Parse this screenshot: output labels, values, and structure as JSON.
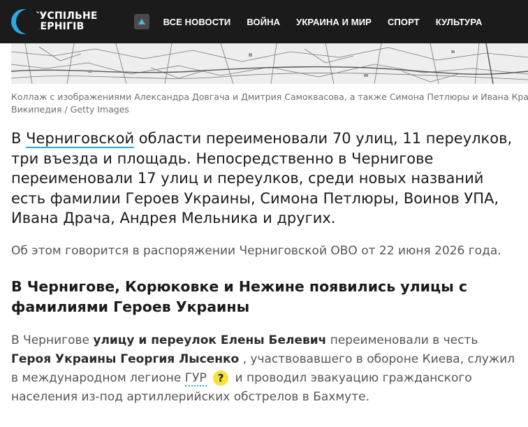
{
  "header": {
    "logo_line1": "СУСПІЛЬНЕ",
    "logo_line2": "ЧЕРНІГІВ",
    "nav": [
      "ВСЕ НОВОСТИ",
      "ВОЙНА",
      "УКРАИНА И МИР",
      "СПОРТ",
      "КУЛЬТУРА"
    ]
  },
  "image": {
    "caption_line1": "Коллаж с изображениями Александра Довгача и Дмитрия Самоквасова, а также Симона Петлюры и Ивана Краснос",
    "caption_line2": "Википедия / Getty Images"
  },
  "article": {
    "lead_before": "В ",
    "lead_link": "Черниговской",
    "lead_after": " области переименовали 70 улиц, 11 переулков, три въезда и площадь. Непосредственно в Чернигове переименовали 17 улиц и переулков, среди новых названий есть фамилии Героев Украины, Симона Петлюры, Воинов УПА, Ивана Драча, Андрея Мельника и других.",
    "p1": "Об этом говорится в распоряжении Черниговской ОВО от 22 июня 2026 года.",
    "h2": "В Чернигове, Корюковке и Нежине появились улицы с фамилиями Героев Украины",
    "p2_a": "В Чернигове ",
    "p2_b": "улицу и переулок Елены Белевич",
    "p2_c": " переименовали в честь ",
    "p2_d": "Героя Украины Георгия Лысенко",
    "p2_e": " , участвовавшего в обороне Киева, служил в международном легионе ",
    "p2_gur": "ГУР",
    "p2_q": "?",
    "p2_f": " и проводил эвакуацию гражданского населения из-под артиллерийских обстрелов в Бахмуте."
  },
  "colors": {
    "header_bg": "#1b1b1b",
    "accent": "#2aa9e0",
    "tooltip_badge": "#f3e33a"
  }
}
